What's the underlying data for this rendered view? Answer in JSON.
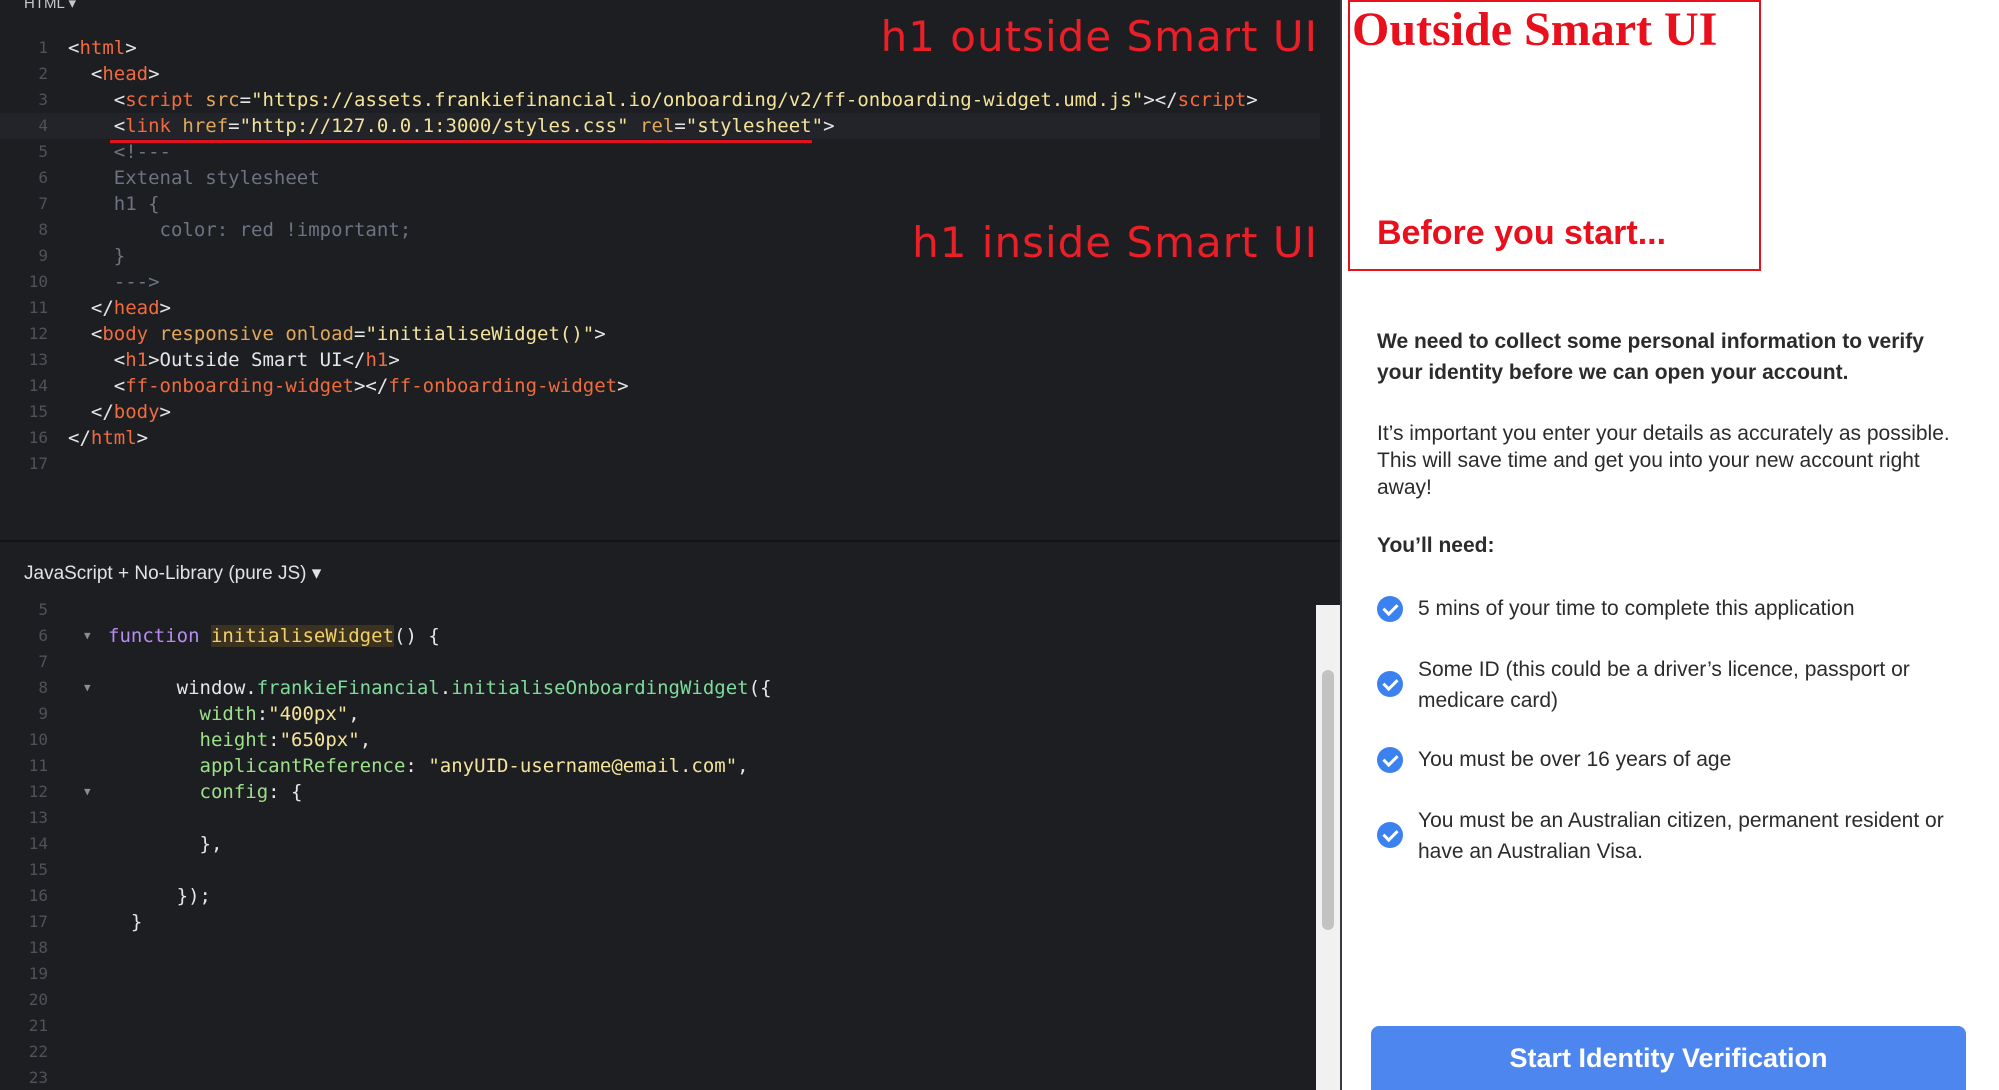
{
  "html_panel": {
    "title": "HTML ▾",
    "lines": [
      {
        "n": "1",
        "segs": [
          [
            "t-plain",
            "<"
          ],
          [
            "t-tag",
            "html"
          ],
          [
            "t-plain",
            ">"
          ]
        ]
      },
      {
        "n": "2",
        "segs": [
          [
            "t-plain",
            "  <"
          ],
          [
            "t-tag",
            "head"
          ],
          [
            "t-plain",
            ">"
          ]
        ]
      },
      {
        "n": "3",
        "segs": [
          [
            "t-plain",
            "    <"
          ],
          [
            "t-tag",
            "script"
          ],
          [
            "t-attr",
            " src"
          ],
          [
            "t-plain",
            "="
          ],
          [
            "t-str",
            "\"https://assets.frankiefinancial.io/onboarding/v2/ff-onboarding-widget.umd.js\""
          ],
          [
            "t-plain",
            "></"
          ],
          [
            "t-tag",
            "script"
          ],
          [
            "t-plain",
            ">"
          ]
        ]
      },
      {
        "n": "4",
        "active": true,
        "segs": [
          [
            "t-plain",
            "    <"
          ],
          [
            "t-tag",
            "link"
          ],
          [
            "t-attr",
            " href"
          ],
          [
            "t-plain",
            "="
          ],
          [
            "t-str",
            "\"http://127.0.0.1:3000/styles.css\""
          ],
          [
            "t-attr",
            " rel"
          ],
          [
            "t-plain",
            "="
          ],
          [
            "t-str",
            "\"stylesheet\""
          ],
          [
            "t-plain",
            ">"
          ]
        ]
      },
      {
        "n": "5",
        "segs": [
          [
            "t-comment",
            "    <!---"
          ]
        ]
      },
      {
        "n": "6",
        "segs": [
          [
            "t-comment",
            "    Extenal stylesheet"
          ]
        ]
      },
      {
        "n": "7",
        "segs": [
          [
            "t-comment",
            "    h1 {"
          ]
        ]
      },
      {
        "n": "8",
        "segs": [
          [
            "t-comment",
            "        color: red !important;"
          ]
        ]
      },
      {
        "n": "9",
        "segs": [
          [
            "t-comment",
            "    }"
          ]
        ]
      },
      {
        "n": "10",
        "segs": [
          [
            "t-comment",
            "    --->"
          ]
        ]
      },
      {
        "n": "11",
        "segs": [
          [
            "t-plain",
            "  </"
          ],
          [
            "t-tag",
            "head"
          ],
          [
            "t-plain",
            ">"
          ]
        ]
      },
      {
        "n": "12",
        "segs": [
          [
            "t-plain",
            "  <"
          ],
          [
            "t-tag",
            "body"
          ],
          [
            "t-attr",
            " responsive onload"
          ],
          [
            "t-plain",
            "="
          ],
          [
            "t-str",
            "\"initialiseWidget()\""
          ],
          [
            "t-plain",
            ">"
          ]
        ]
      },
      {
        "n": "13",
        "segs": [
          [
            "t-plain",
            "    <"
          ],
          [
            "t-tag",
            "h1"
          ],
          [
            "t-plain",
            ">Outside Smart UI</"
          ],
          [
            "t-tag",
            "h1"
          ],
          [
            "t-plain",
            ">"
          ]
        ]
      },
      {
        "n": "14",
        "segs": [
          [
            "t-plain",
            "    <"
          ],
          [
            "t-tag",
            "ff-onboarding-widget"
          ],
          [
            "t-plain",
            "></"
          ],
          [
            "t-tag",
            "ff-onboarding-widget"
          ],
          [
            "t-plain",
            ">"
          ]
        ]
      },
      {
        "n": "15",
        "segs": [
          [
            "t-plain",
            "  </"
          ],
          [
            "t-tag",
            "body"
          ],
          [
            "t-plain",
            ">"
          ]
        ]
      },
      {
        "n": "16",
        "segs": [
          [
            "t-plain",
            "</"
          ],
          [
            "t-tag",
            "html"
          ],
          [
            "t-plain",
            ">"
          ]
        ]
      },
      {
        "n": "17",
        "segs": []
      }
    ]
  },
  "annotations": {
    "outside_label": "h1 outside Smart UI",
    "inside_label": "h1 inside Smart UI"
  },
  "js_panel": {
    "title": "JavaScript + No-Library (pure JS) ▾",
    "lines": [
      {
        "n": "5",
        "segs": []
      },
      {
        "n": "6",
        "fold": true,
        "segs": [
          [
            "t-kw",
            "function"
          ],
          [
            "t-plain",
            " "
          ],
          [
            "t-fn",
            "initialiseWidget"
          ],
          [
            "t-plain",
            "() {"
          ]
        ]
      },
      {
        "n": "7",
        "segs": []
      },
      {
        "n": "8",
        "fold": true,
        "segs": [
          [
            "t-plain",
            "      window."
          ],
          [
            "t-method",
            "frankieFinancial"
          ],
          [
            "t-plain",
            "."
          ],
          [
            "t-method",
            "initialiseOnboardingWidget"
          ],
          [
            "t-plain",
            "({"
          ]
        ]
      },
      {
        "n": "9",
        "segs": [
          [
            "t-prop",
            "        width"
          ],
          [
            "t-plain",
            ":"
          ],
          [
            "t-str",
            "\"400px\""
          ],
          [
            "t-plain",
            ","
          ]
        ]
      },
      {
        "n": "10",
        "segs": [
          [
            "t-prop",
            "        height"
          ],
          [
            "t-plain",
            ":"
          ],
          [
            "t-str",
            "\"650px\""
          ],
          [
            "t-plain",
            ","
          ]
        ]
      },
      {
        "n": "11",
        "segs": [
          [
            "t-prop",
            "        applicantReference"
          ],
          [
            "t-plain",
            ": "
          ],
          [
            "t-str",
            "\"anyUID-username@email.com\""
          ],
          [
            "t-plain",
            ","
          ]
        ]
      },
      {
        "n": "12",
        "fold": true,
        "segs": [
          [
            "t-prop",
            "        config"
          ],
          [
            "t-plain",
            ": {"
          ]
        ]
      },
      {
        "n": "13",
        "segs": []
      },
      {
        "n": "14",
        "segs": [
          [
            "t-plain",
            "        },"
          ]
        ]
      },
      {
        "n": "15",
        "segs": []
      },
      {
        "n": "16",
        "segs": [
          [
            "t-plain",
            "      });"
          ]
        ]
      },
      {
        "n": "17",
        "segs": [
          [
            "t-plain",
            "  }"
          ]
        ]
      },
      {
        "n": "18",
        "segs": []
      },
      {
        "n": "19",
        "segs": []
      },
      {
        "n": "20",
        "segs": []
      },
      {
        "n": "21",
        "segs": []
      },
      {
        "n": "22",
        "segs": []
      },
      {
        "n": "23",
        "segs": []
      }
    ]
  },
  "preview": {
    "outside_heading": "Outside Smart UI",
    "inside_heading": "Before you start...",
    "intro": "We need to collect some personal information to verify your identity before we can open your account.",
    "detail": "It’s important you enter your details as accurately as possible. This will save time and get you into your new account right away!",
    "need_label": "You’ll need:",
    "requirements": [
      "5 mins of your time to complete this application",
      "Some ID (this could be a driver’s licence, passport or medicare card)",
      "You must be over 16 years of age",
      "You must be an Australian citizen, permanent resident or have an Australian Visa."
    ],
    "start_button": "Start Identity Verification",
    "colors": {
      "accent": "#4d86ee",
      "check": "#3b82f0",
      "annotation_red": "#e8101d"
    }
  }
}
